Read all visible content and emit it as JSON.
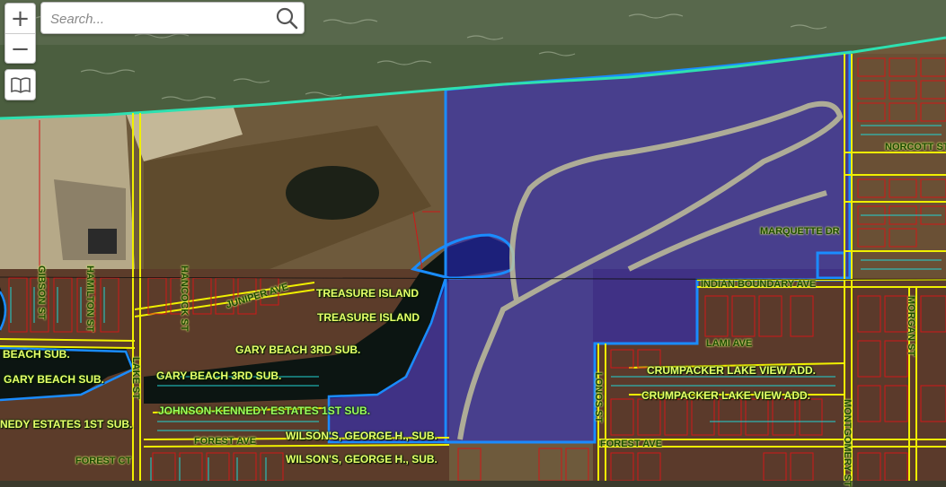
{
  "search": {
    "placeholder": "Search..."
  },
  "controls": {
    "zoom_in": "+",
    "zoom_out": "−"
  },
  "labels": {
    "norcott": "NORCOTT ST",
    "marquette": "MARQUETTE DR",
    "indian_boundary": "INDIAN BOUNDARY AVE",
    "lami": "LAMI AVE",
    "treasure_island_1": "TREASURE ISLAND",
    "treasure_island_2": "TREASURE ISLAND",
    "juniper": "JUNIPER AVE",
    "gibson": "GIBSON ST",
    "hamilton": "HAMILTON ST",
    "hancock": "HANCOCK ST",
    "lake": "LAKE ST",
    "beach_sub": "BEACH SUB.",
    "gary_beach_sub": "GARY BEACH SUB.",
    "gary_beach_3rd_1": "GARY BEACH 3RD SUB.",
    "gary_beach_3rd_2": "GARY BEACH 3RD SUB.",
    "johnson_kennedy": "JOHNSON-KENNEDY ESTATES 1ST SUB.",
    "kennedy_1st": "NEDY ESTATES 1ST SUB.",
    "wilsons_1": "WILSON'S, GEORGE H., SUB.",
    "wilsons_2": "WILSON'S, GEORGE H., SUB.",
    "forest_ave_1": "FOREST AVE",
    "forest_ave_2": "FOREST AVE",
    "forest_ct": "FOREST CT",
    "crumpacker_1": "CRUMPACKER LAKE VIEW ADD.",
    "crumpacker_2": "CRUMPACKER LAKE VIEW ADD.",
    "lonos": "LONOS ST",
    "morgan": "MORGAN ST",
    "montgomery": "MONTGOMERY ST"
  },
  "colors": {
    "lake": "#4b5e3f",
    "shoreline": "#2ee0b0",
    "parcel_selection": "#2a2ad0",
    "selection_outline": "#1a8cff",
    "street_line": "#f0f000",
    "parcel_line": "#d01818",
    "lot_line": "#22d3d3",
    "pond": "#0c1512"
  }
}
